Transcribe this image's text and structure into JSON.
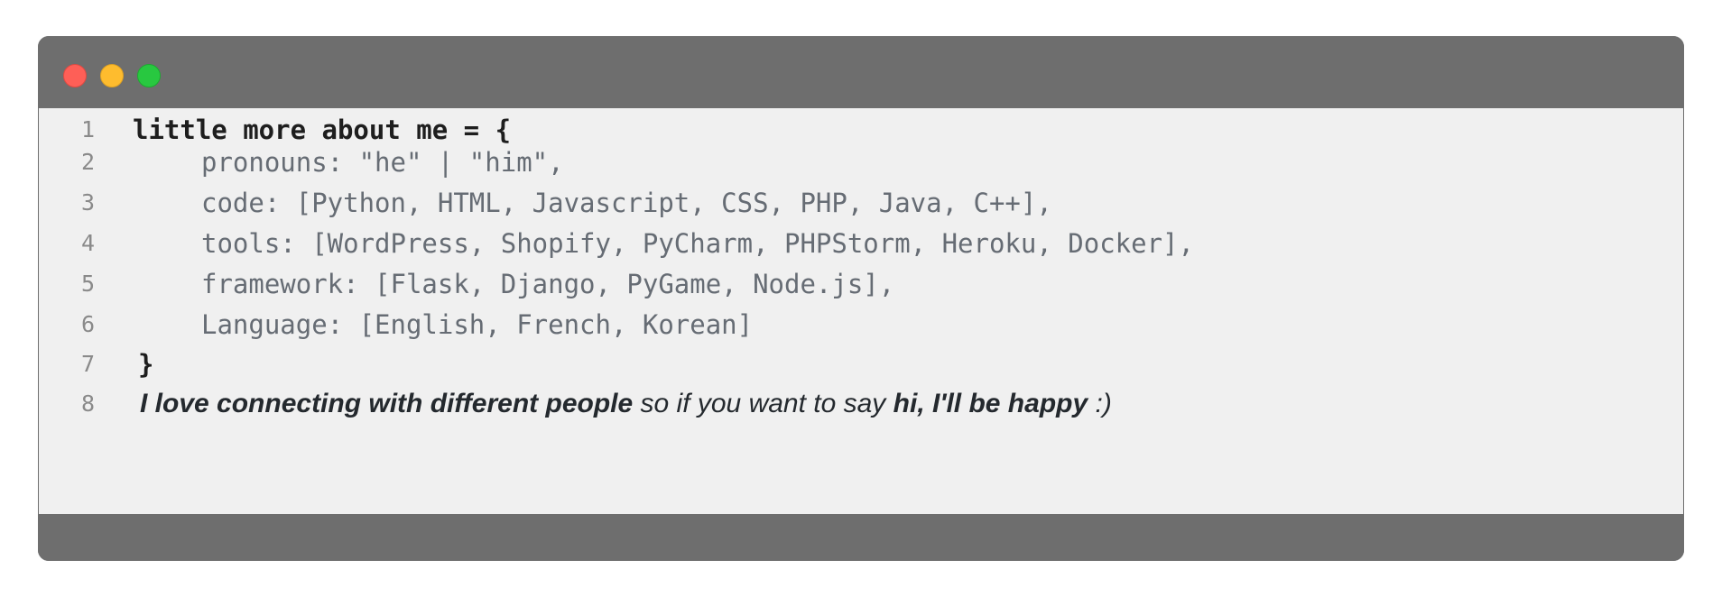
{
  "window": {
    "controls": [
      "close",
      "minimize",
      "maximize"
    ]
  },
  "editor": {
    "lines": [
      {
        "number": "1",
        "text": "little more about me = {"
      },
      {
        "number": "2",
        "text": "pronouns: \"he\" | \"him\","
      },
      {
        "number": "3",
        "text": "code: [Python, HTML, Javascript, CSS, PHP, Java, C++],"
      },
      {
        "number": "4",
        "text": "tools: [WordPress, Shopify, PyCharm, PHPStorm, Heroku, Docker],"
      },
      {
        "number": "5",
        "text": "framework: [Flask, Django, PyGame, Node.js],"
      },
      {
        "number": "6",
        "text": "Language: [English, French, Korean]"
      },
      {
        "number": "7",
        "text": "}"
      },
      {
        "number": "8",
        "segments": [
          "I love connecting with different people",
          " so if you want to say ",
          "hi, I'll be happy",
          " :)"
        ]
      }
    ]
  },
  "colors": {
    "chrome": "#6e6e6e",
    "editor_bg": "#f0f0f0",
    "keyword_text": "#1e1e1e",
    "value_text": "#666c74",
    "close": "#fe5f57",
    "minimize": "#febc2e",
    "maximize": "#28c840"
  }
}
